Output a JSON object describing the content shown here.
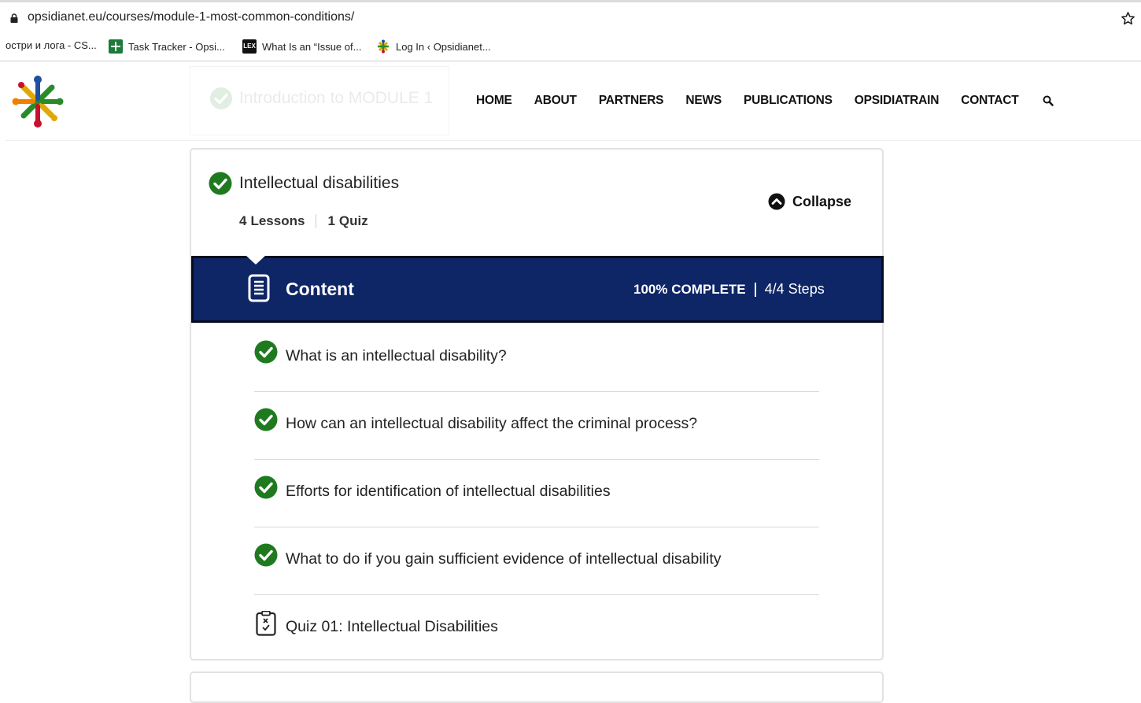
{
  "browser": {
    "url": "opsidianet.eu/courses/module-1-most-common-conditions/",
    "bookmarks": [
      {
        "label": "остри и лога - CS...",
        "icon": "none"
      },
      {
        "label": "Task Tracker - Opsi...",
        "icon": "task-tracker-icon"
      },
      {
        "label": "What Is an “Issue of...",
        "icon": "lex-icon"
      },
      {
        "label": "Log In ‹ Opsidianet...",
        "icon": "opsidianet-icon"
      }
    ]
  },
  "header": {
    "ghost_title": "Introduction to MODULE 1",
    "nav": [
      "HOME",
      "ABOUT",
      "PARTNERS",
      "NEWS",
      "PUBLICATIONS",
      "OPSIDIATRAIN",
      "CONTACT"
    ]
  },
  "topic": {
    "title": "Intellectual disabilities",
    "lessons_count": "4",
    "lessons_label": "Lessons",
    "quiz_count": "1",
    "quiz_label": "Quiz",
    "collapse_label": "Collapse"
  },
  "content_bar": {
    "title": "Content",
    "percent_complete": "100% COMPLETE",
    "steps": "4/4 Steps"
  },
  "lessons": [
    {
      "title": "What is an intellectual disability?",
      "type": "lesson",
      "completed": true
    },
    {
      "title": "How can an intellectual disability affect the criminal process?",
      "type": "lesson",
      "completed": true
    },
    {
      "title": "Efforts for identification of intellectual disabilities",
      "type": "lesson",
      "completed": true
    },
    {
      "title": "What to do if you gain sufficient evidence of intellectual disability",
      "type": "lesson",
      "completed": true
    },
    {
      "title": "Quiz 01: Intellectual Disabilities",
      "type": "quiz",
      "completed": false
    }
  ],
  "colors": {
    "content_bar": "#0e2566",
    "check_green": "#1f7a1f"
  }
}
